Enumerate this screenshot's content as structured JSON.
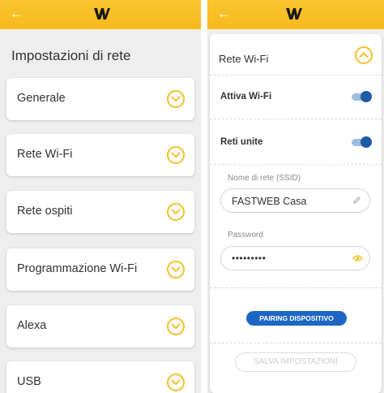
{
  "left": {
    "title": "Impostazioni di rete",
    "items": [
      {
        "label": "Generale"
      },
      {
        "label": "Rete Wi-Fi"
      },
      {
        "label": "Rete ospiti"
      },
      {
        "label": "Programmazione Wi-Fi"
      },
      {
        "label": "Alexa"
      },
      {
        "label": "USB"
      }
    ]
  },
  "right": {
    "title": "Rete Wi-Fi",
    "wifi_toggle_label": "Attiva Wi-Fi",
    "wifi_enabled": true,
    "merged_toggle_label": "Reti unite",
    "merged_enabled": true,
    "ssid_label": "Nome di rete (SSID)",
    "ssid_value": "FASTWEB Casa",
    "password_label": "Password",
    "password_value": "•••••••••",
    "pairing_button": "PAIRING DISPOSITIVO",
    "save_button": "SALVA IMPOSTAZIONI"
  },
  "colors": {
    "header": "#f6b91c",
    "accent_yellow": "#f3c12b",
    "primary_blue": "#1e66c4"
  },
  "icons": [
    "back-arrow-icon",
    "fastweb-logo-icon",
    "chevron-down-icon",
    "chevron-up-icon",
    "pencil-icon",
    "eye-icon"
  ]
}
